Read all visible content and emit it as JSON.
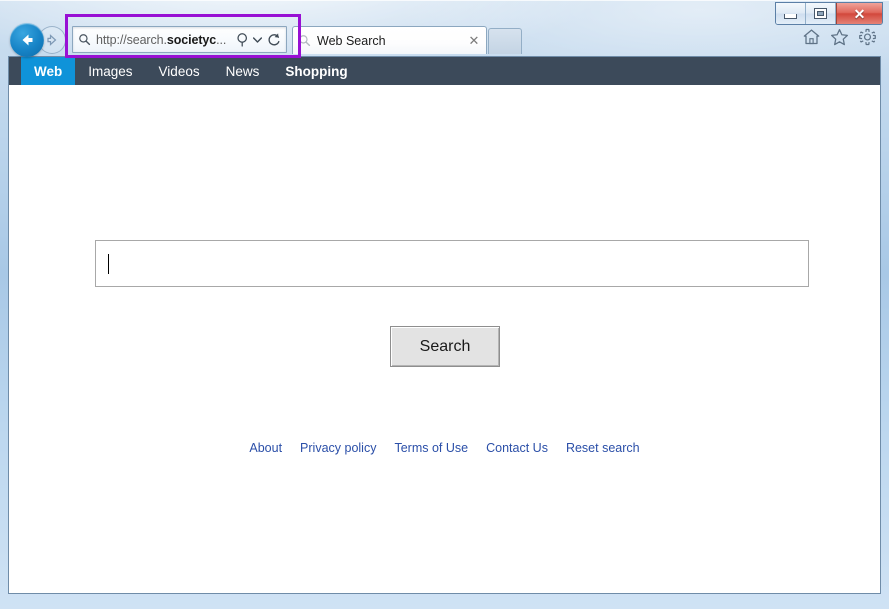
{
  "window": {
    "controls": {
      "minimize_label": "Minimize",
      "restore_label": "Restore",
      "close_label": "✕"
    }
  },
  "browser": {
    "back_label": "Back",
    "forward_label": "Forward",
    "address_bar": {
      "url_prefix": "http://search.",
      "url_domain": "societyc",
      "url_suffix": "...",
      "full_url": "http://search.societyc...",
      "search_icon": "search-icon",
      "dropdown_icon": "chevron-down-icon",
      "refresh_icon": "refresh-icon"
    },
    "tabs": [
      {
        "label": "Web Search",
        "close_label": "✕",
        "icon": "search-icon"
      }
    ],
    "new_tab_label": "New Tab",
    "toolbar_icons": [
      {
        "name": "home-icon",
        "label": "Home"
      },
      {
        "name": "favorites-star-icon",
        "label": "Favorites"
      },
      {
        "name": "settings-gear-icon",
        "label": "Tools"
      }
    ]
  },
  "page": {
    "nav": [
      {
        "label": "Web",
        "active": true
      },
      {
        "label": "Images",
        "active": false
      },
      {
        "label": "Videos",
        "active": false
      },
      {
        "label": "News",
        "active": false
      },
      {
        "label": "Shopping",
        "active": false
      }
    ],
    "search": {
      "value": "",
      "placeholder": "",
      "button_label": "Search"
    },
    "footer_links": [
      {
        "label": "About"
      },
      {
        "label": "Privacy policy"
      },
      {
        "label": "Terms of Use"
      },
      {
        "label": "Contact Us"
      },
      {
        "label": "Reset search"
      }
    ]
  },
  "annotation": {
    "color": "#9810d4",
    "target": "address-bar"
  },
  "colors": {
    "nav_bar": "#3c4a5a",
    "nav_active": "#0f93d9",
    "link": "#2b4fa8",
    "annotation": "#9810d4",
    "close_button": "#d2483c"
  }
}
